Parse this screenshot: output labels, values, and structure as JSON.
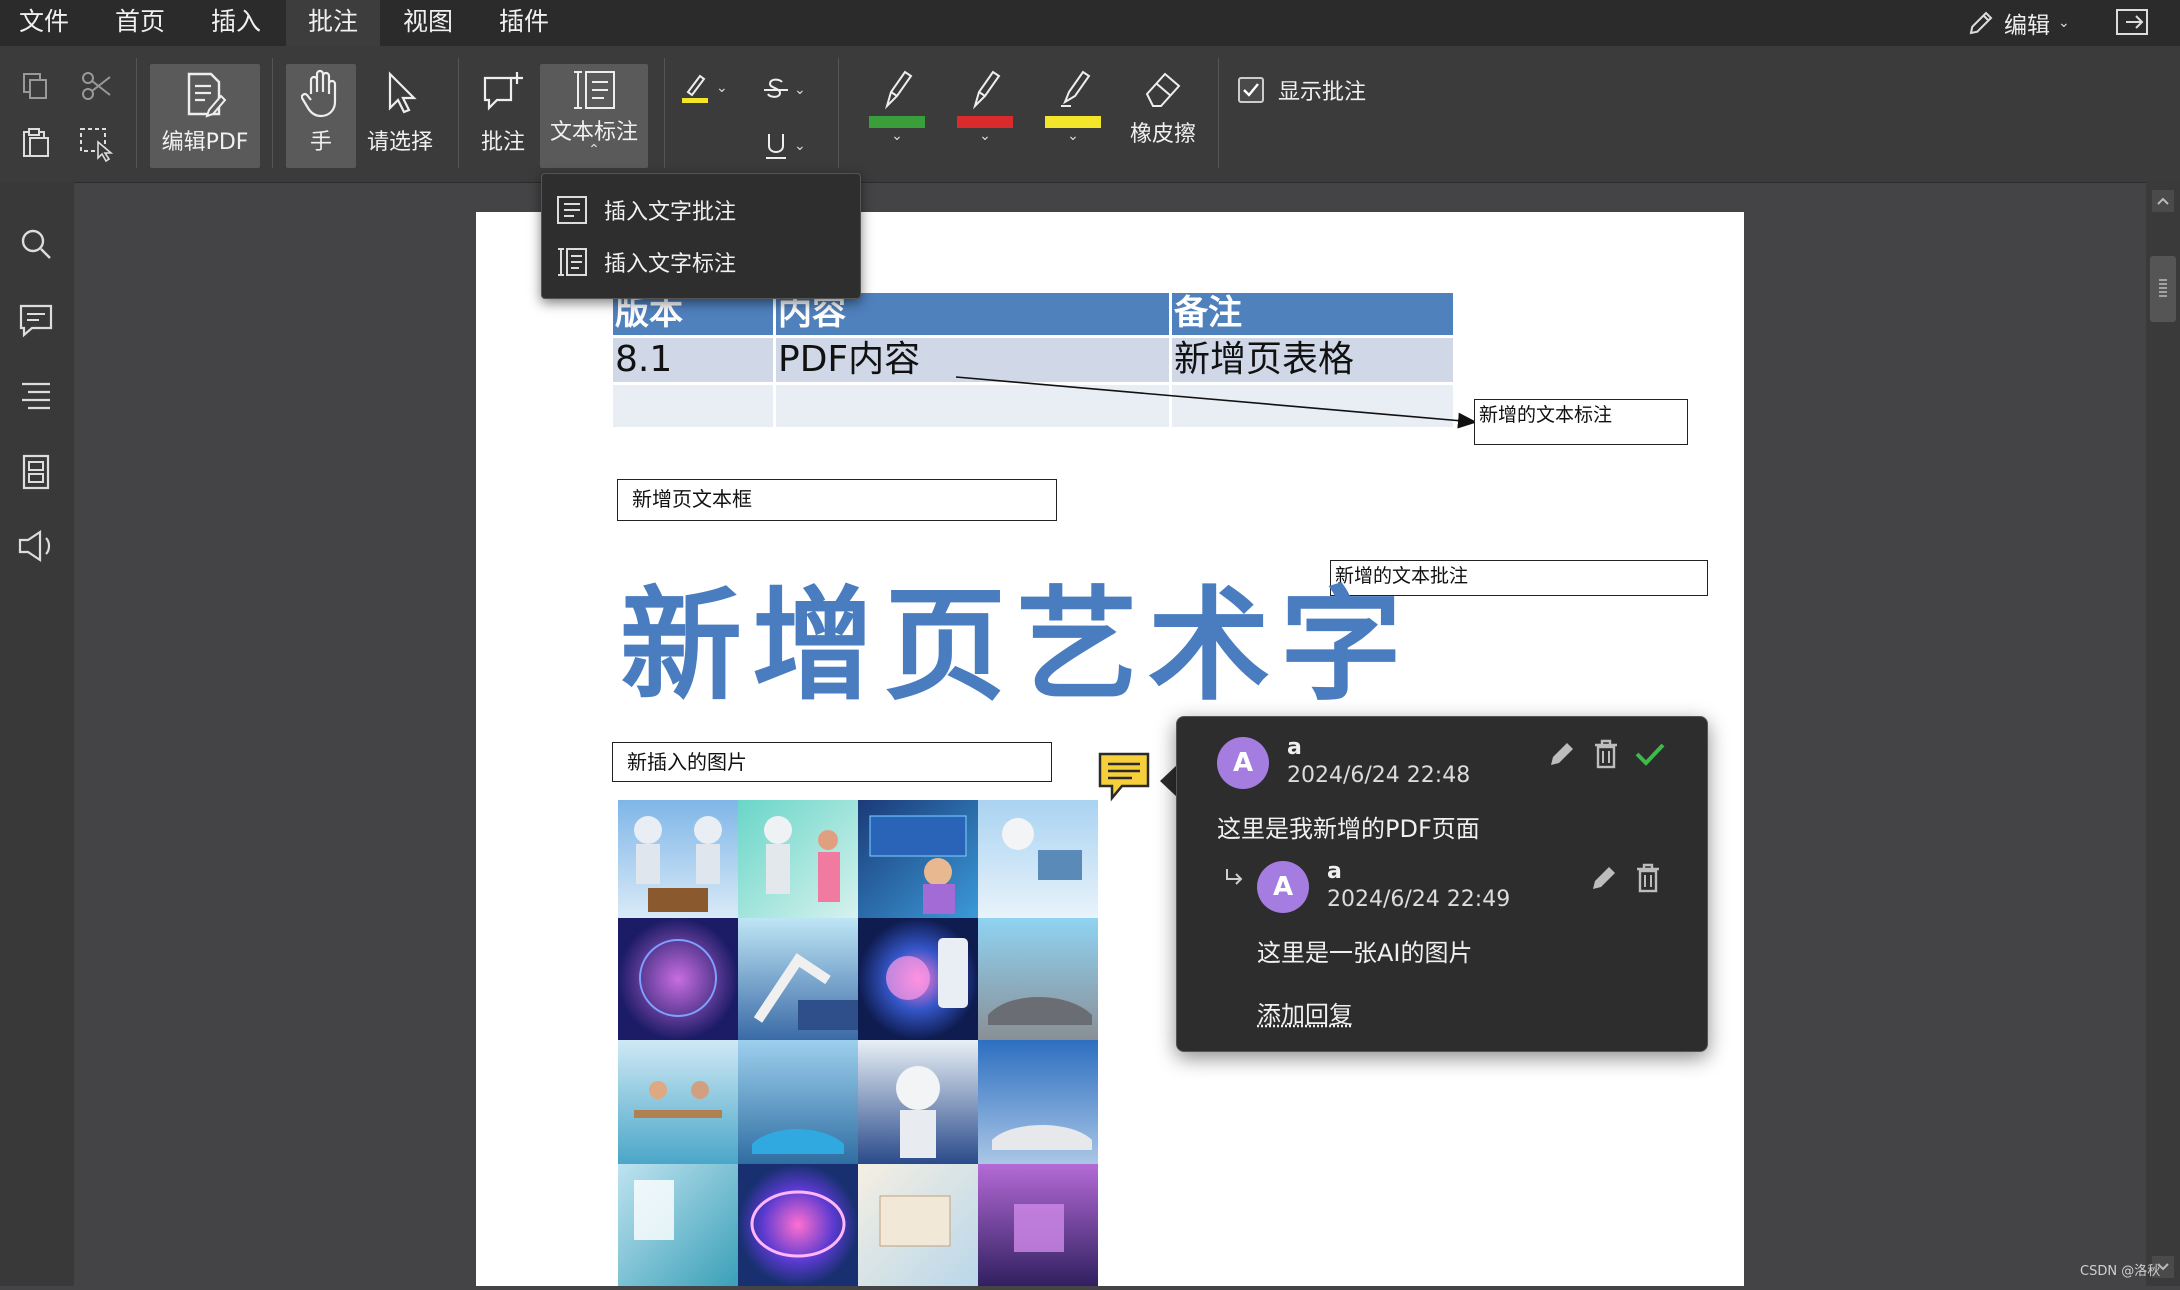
{
  "menu": {
    "items": [
      "文件",
      "首页",
      "插入",
      "批注",
      "视图",
      "插件"
    ],
    "active_index": 3,
    "edit_label": "编辑"
  },
  "toolbar": {
    "edit_pdf": "编辑PDF",
    "hand": "手",
    "select": "请选择",
    "comment": "批注",
    "text_markup": "文本标注",
    "eraser": "橡皮擦",
    "show_comments": "显示批注",
    "show_comments_checked": true,
    "pen_colors": [
      "#3a9e3a",
      "#d92b2b",
      "#f2e52a"
    ],
    "highlight_color": "#f2e52a"
  },
  "dropdown": {
    "items": [
      "插入文字批注",
      "插入文字标注"
    ]
  },
  "document": {
    "table": {
      "headers": [
        "版本",
        "内容",
        "备注"
      ],
      "rows": [
        [
          "8.1",
          "PDF内容",
          "新增页表格"
        ],
        [
          "",
          "",
          ""
        ]
      ]
    },
    "callout_text": "新增的文本标注",
    "textbox_text": "新增页文本框",
    "note_text": "新增的文本批注",
    "wordart": "新增页艺术字",
    "image_caption": "新插入的图片",
    "accent_color": "#4a7cc0"
  },
  "comment_popup": {
    "author": "a",
    "avatar_letter": "A",
    "timestamp": "2024/6/24 22:48",
    "body": "这里是我新增的PDF页面",
    "reply": {
      "author": "a",
      "avatar_letter": "A",
      "timestamp": "2024/6/24 22:49",
      "body": "这里是一张AI的图片"
    },
    "add_reply": "添加回复"
  },
  "watermark": "CSDN @洛秋"
}
